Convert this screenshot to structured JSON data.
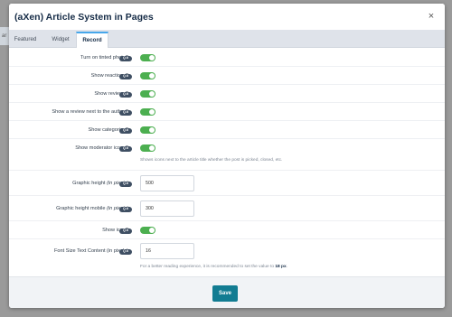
{
  "modal": {
    "title": "(aXen) Article System in Pages",
    "close_glyph": "×"
  },
  "backdrop": {
    "fragment": "ar"
  },
  "tabs": [
    {
      "label": "Featured"
    },
    {
      "label": "Widget"
    },
    {
      "label": "Record",
      "active": true
    }
  ],
  "badge_text": "Q.ti",
  "settings": {
    "tinted_photo": {
      "label": "Turn on tinted photo?",
      "enabled": true
    },
    "show_reactions": {
      "label": "Show reactions?",
      "enabled": true
    },
    "show_reviews": {
      "label": "Show reviews?",
      "enabled": true
    },
    "review_next_author": {
      "label": "Show a review next to the author?",
      "enabled": true
    },
    "show_categories": {
      "label": "Show categories?",
      "enabled": true
    },
    "show_moderator_icons": {
      "label": "Show moderator icons?",
      "enabled": true,
      "hint": "Shows icons next to the article title whether the post is picked, closed, etc."
    },
    "graphic_height": {
      "label_main": "Graphic height",
      "label_suffix": "(in pixels)",
      "value": "500"
    },
    "graphic_height_mobile": {
      "label_main": "Graphic height mobile",
      "label_suffix": "(in pixels)",
      "value": "300"
    },
    "show_icon": {
      "label": "Show icon?",
      "enabled": true
    },
    "font_size_text": {
      "label": "Font Size Text Content (in pixels)",
      "value": "16",
      "hint_prefix": "For a better reading experience, it is recommended to set the value to",
      "hint_value": "18 px",
      "hint_suffix": "."
    }
  },
  "footer": {
    "save_label": "Save"
  },
  "colors": {
    "toggle_on": "#4caf50",
    "primary_button": "#127c92",
    "tab_active_accent": "#47a7eb",
    "title": "#152b46"
  },
  "icons": {
    "close": "close-icon",
    "toggle": "toggle-switch"
  }
}
